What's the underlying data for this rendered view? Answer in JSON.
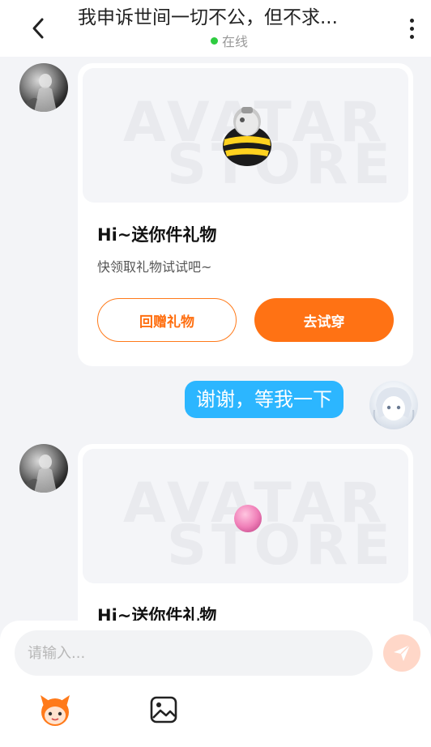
{
  "header": {
    "title": "我申诉世间一切不公，但不求...",
    "status": "在线"
  },
  "gift_cards": [
    {
      "image_watermark_line1": "AVATAR",
      "image_watermark_line2": "STORE",
      "gift_icon": "bee-egg-gift-icon",
      "title": "Hi~送你件礼物",
      "subtitle": "快领取礼物试试吧~",
      "button_return": "回赠礼物",
      "button_try": "去试穿"
    },
    {
      "image_watermark_line1": "AVATAR",
      "image_watermark_line2": "STORE",
      "gift_icon": "pink-ball-gift-icon",
      "title": "Hi~送你件礼物"
    }
  ],
  "sent_message": {
    "text": "谢谢，等我一下"
  },
  "composer": {
    "placeholder": "请输入..."
  },
  "colors": {
    "accent": "#ff7214",
    "bubble": "#2cb6ff",
    "online": "#2ecc40"
  }
}
